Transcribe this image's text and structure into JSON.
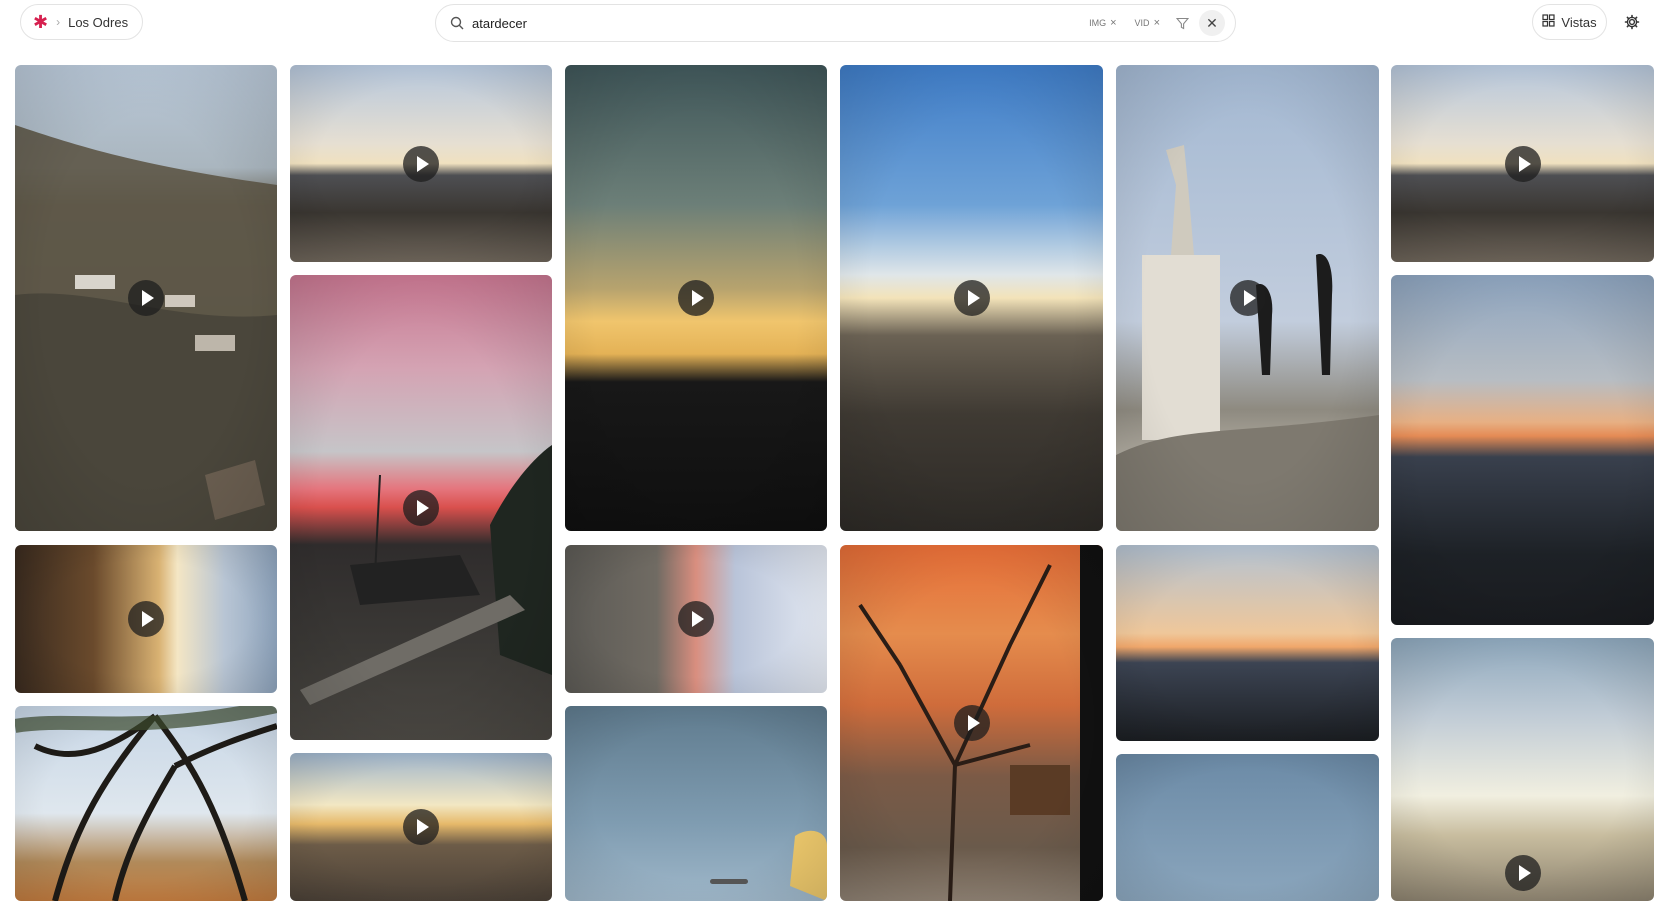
{
  "breadcrumb": {
    "location": "Los Odres"
  },
  "search": {
    "query": "atardecer",
    "chips": [
      "IMG",
      "VID"
    ]
  },
  "header": {
    "views_label": "Vistas"
  },
  "icons": {
    "logo": "asterisk-logo",
    "search": "search-icon",
    "filter": "filter-icon",
    "clear": "close-icon",
    "views": "grid-icon",
    "settings": "gear-icon",
    "play": "play-icon"
  },
  "media": [
    {
      "type": "video",
      "scene": "hillside-village"
    },
    {
      "type": "video",
      "scene": "sunset-horizon-rocks"
    },
    {
      "type": "video",
      "scene": "pink-clouds-cabin"
    },
    {
      "type": "video",
      "scene": "sunset-silhouette-hills"
    },
    {
      "type": "video",
      "scene": "blue-sky-sunset-valley"
    },
    {
      "type": "video",
      "scene": "statue-hikers"
    },
    {
      "type": "video",
      "scene": "sunset-horizon-rocks"
    },
    {
      "type": "image",
      "scene": "orange-horizon-dusk"
    },
    {
      "type": "video",
      "scene": "rotated-sunset-rock"
    },
    {
      "type": "video",
      "scene": "rotated-pink-sunset"
    },
    {
      "type": "video",
      "scene": "orange-tree-cabin"
    },
    {
      "type": "image",
      "scene": "dusk-mountains"
    },
    {
      "type": "video",
      "scene": "sun-low-plain"
    },
    {
      "type": "image",
      "scene": "tree-branches"
    },
    {
      "type": "video",
      "scene": "sunset-field-rocks"
    },
    {
      "type": "image",
      "scene": "blue-sky-cloud"
    },
    {
      "type": "image",
      "scene": "blue-sky-plain"
    }
  ]
}
